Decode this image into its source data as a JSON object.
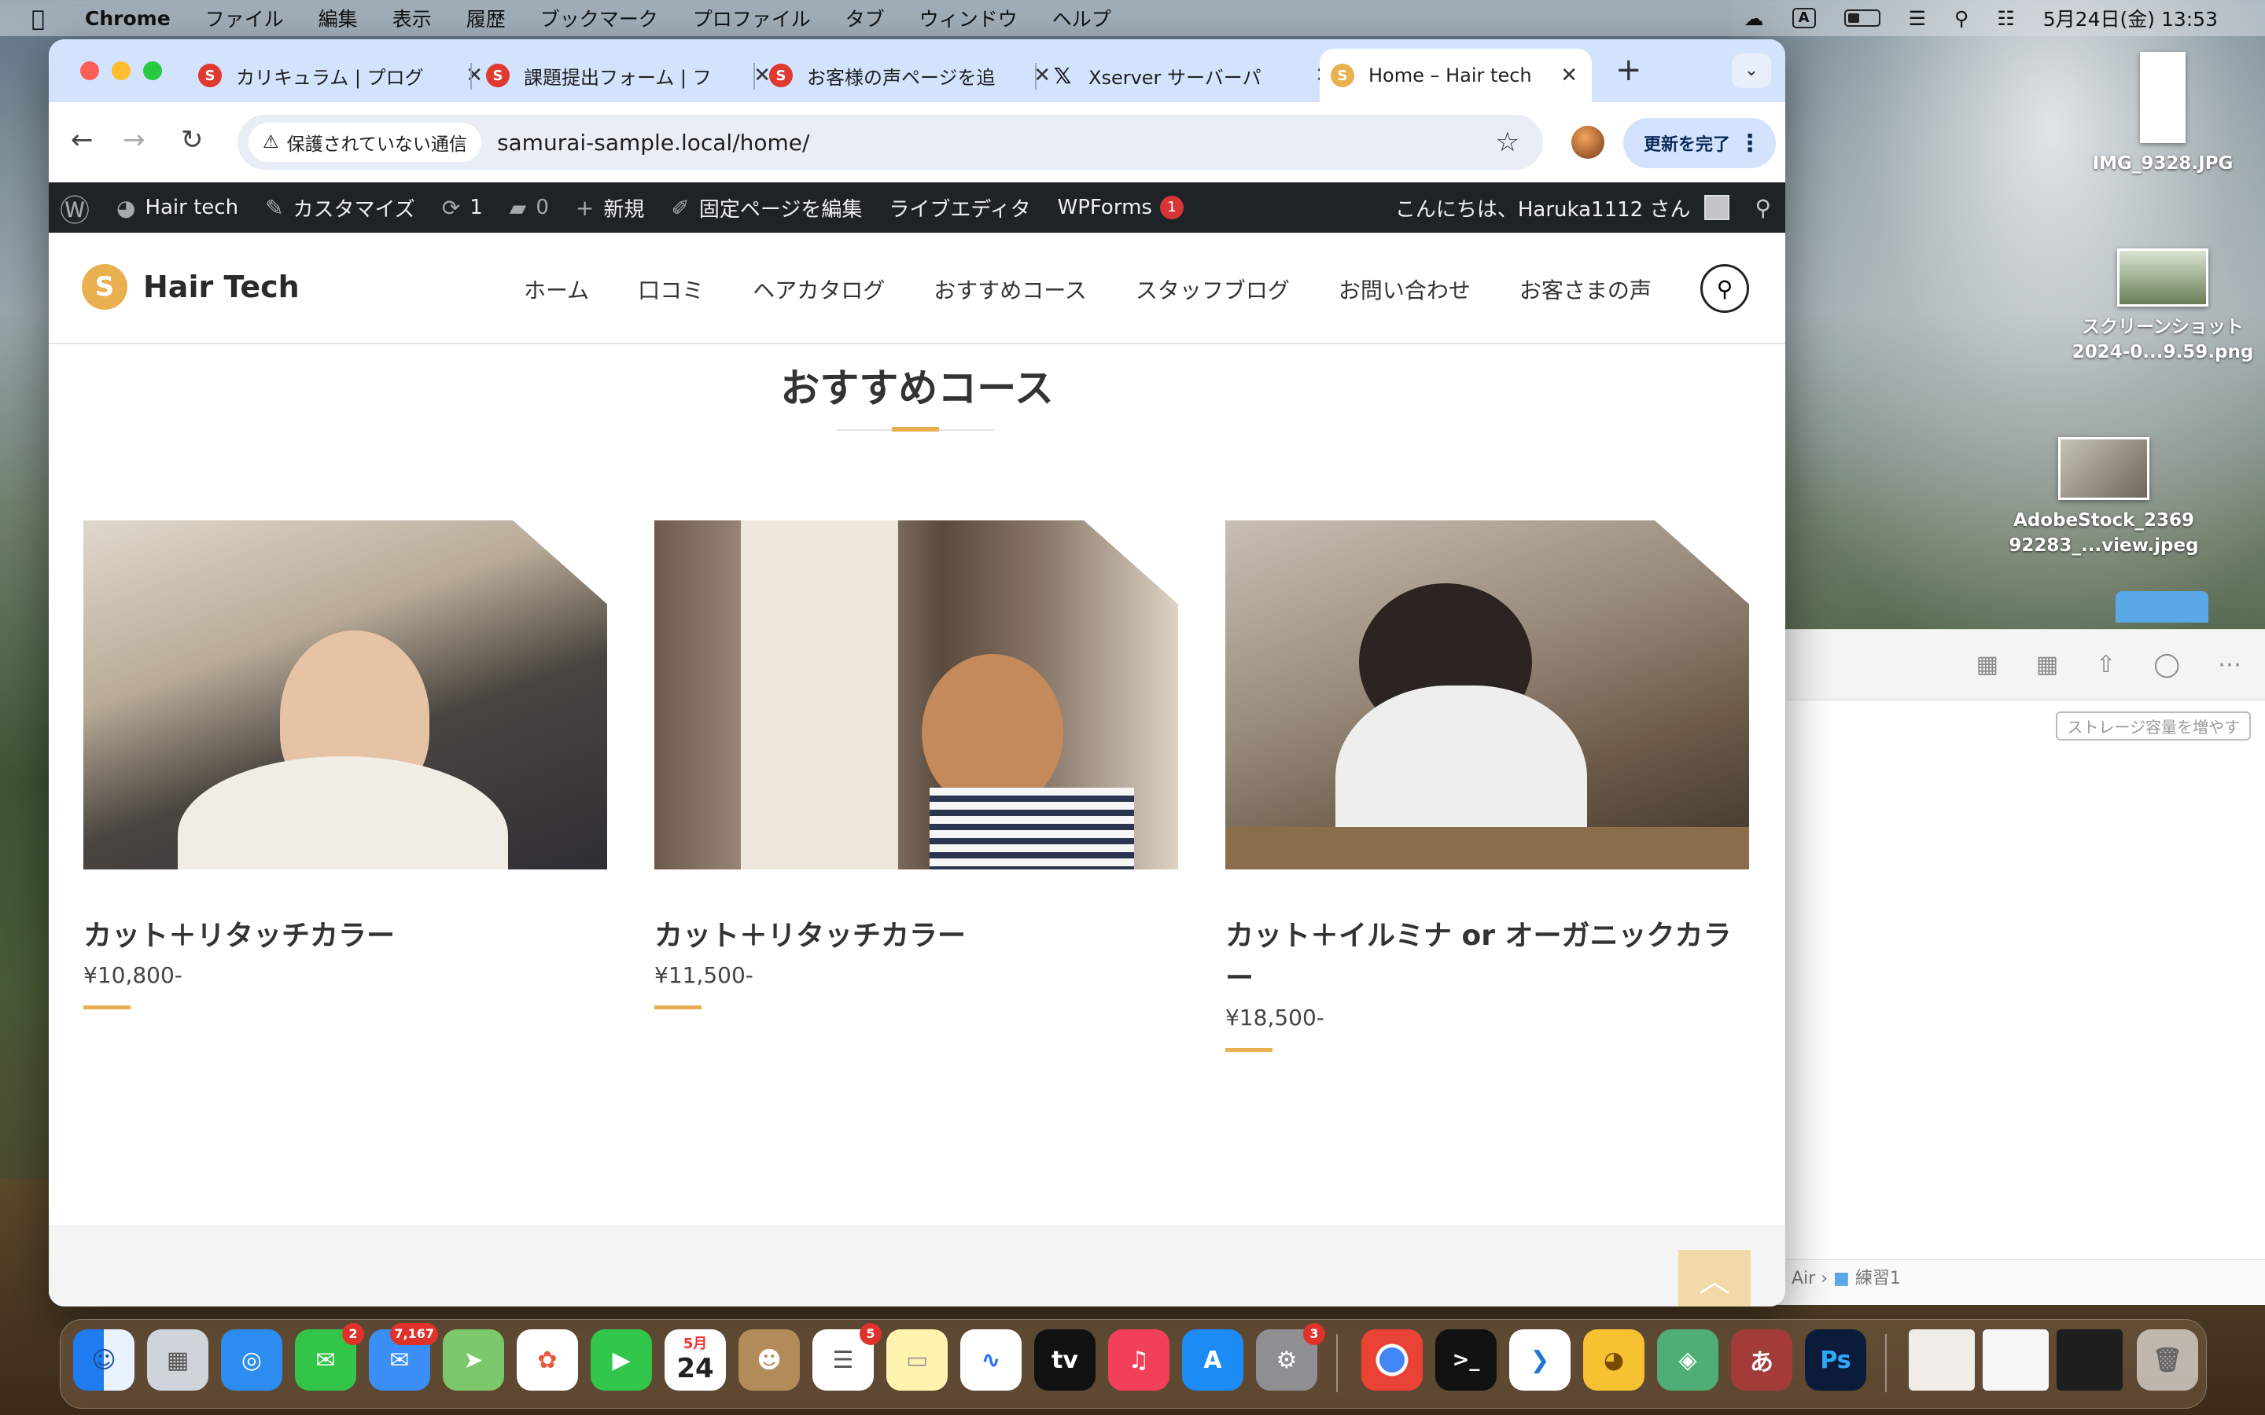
{
  "menubar": {
    "app": "Chrome",
    "items": [
      "ファイル",
      "編集",
      "表示",
      "履歴",
      "ブックマーク",
      "プロファイル",
      "タブ",
      "ウィンドウ",
      "ヘルプ"
    ],
    "input_mode": "A",
    "clock": "5月24日(金)  13:53"
  },
  "desktop": {
    "files": [
      {
        "label": "IMG_9328.JPG"
      },
      {
        "label": "スクリーンショット 2024-0...9.59.png"
      },
      {
        "label": "AdobeStock_2369 92283_...view.jpeg"
      }
    ]
  },
  "finder": {
    "storage_button": "ストレージ容量を増やす",
    "path_prefix": "Air",
    "path_folder": "練習1"
  },
  "browser": {
    "tabs": [
      {
        "title": "カリキュラム | プログ"
      },
      {
        "title": "課題提出フォーム | フ"
      },
      {
        "title": "お客様の声ページを追"
      },
      {
        "title": "Xserver サーバーパ"
      },
      {
        "title": "Home – Hair tech"
      }
    ],
    "security_label": "保護されていない通信",
    "url_host": "samurai-sample.local",
    "url_path": "/home/",
    "update_button": "更新を完了"
  },
  "wpadmin": {
    "site_name": "Hair tech",
    "customize": "カスタマイズ",
    "updates": "1",
    "comments": "0",
    "new": "新規",
    "edit_page": "固定ページを編集",
    "live_editor": "ライブエディタ",
    "wpforms": "WPForms",
    "wpforms_badge": "1",
    "greeting": "こんにちは、Haruka1112 さん"
  },
  "site": {
    "logo_text": "Hair Tech",
    "nav": [
      "ホーム",
      "口コミ",
      "ヘアカタログ",
      "おすすめコース",
      "スタッフブログ",
      "お問い合わせ",
      "お客さまの声"
    ],
    "section_title": "おすすめコース",
    "courses": [
      {
        "title": "カット＋リタッチカラー",
        "price": "¥10,800-"
      },
      {
        "title": "カット＋リタッチカラー",
        "price": "¥11,500-"
      },
      {
        "title": "カット＋イルミナ or オーガニックカラー",
        "price": "¥18,500-"
      }
    ]
  },
  "dock": {
    "badges": {
      "messages": "2",
      "mail": "7,167",
      "reminders": "5",
      "settings": "3"
    },
    "calendar_month": "5月",
    "calendar_day": "24",
    "tv_label": "tv",
    "ps_label": "Ps",
    "ime_label": "あ"
  },
  "colors": {
    "accent": "#e8b04e",
    "wp_bar": "#1d2327",
    "tab_strip": "#d3e3fd"
  }
}
